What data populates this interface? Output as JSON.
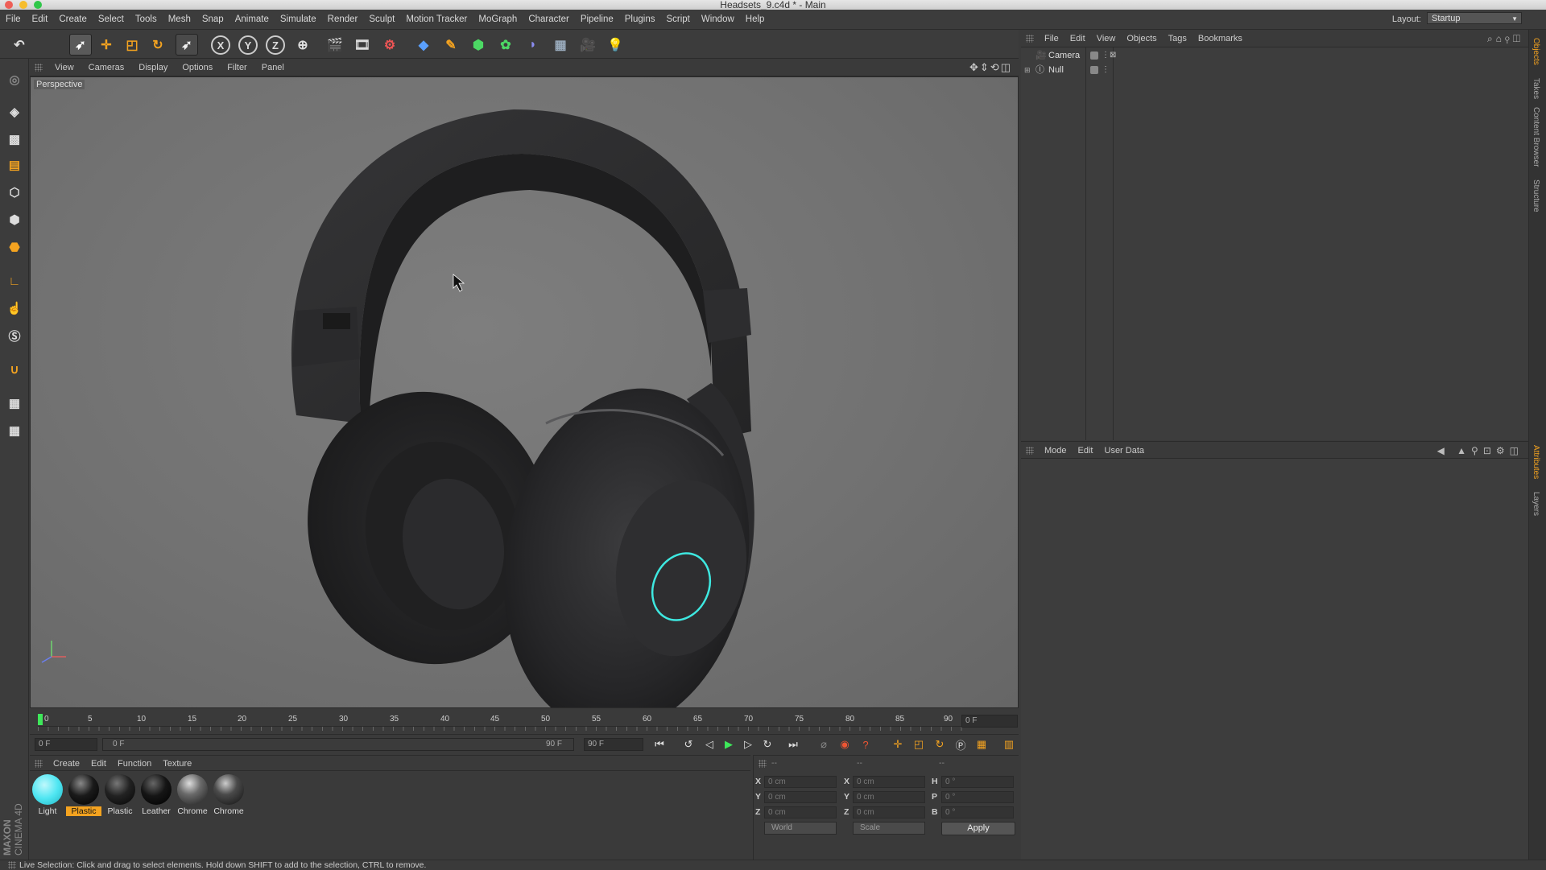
{
  "window": {
    "title": "Headsets_9.c4d * - Main"
  },
  "menu": [
    "File",
    "Edit",
    "Create",
    "Select",
    "Tools",
    "Mesh",
    "Snap",
    "Animate",
    "Simulate",
    "Render",
    "Sculpt",
    "Motion Tracker",
    "MoGraph",
    "Character",
    "Pipeline",
    "Plugins",
    "Script",
    "Window",
    "Help"
  ],
  "layout": {
    "label": "Layout:",
    "value": "Startup"
  },
  "viewport": {
    "menu": [
      "View",
      "Cameras",
      "Display",
      "Options",
      "Filter",
      "Panel"
    ],
    "label": "Perspective"
  },
  "timeline": {
    "ticks": [
      "0",
      "5",
      "10",
      "15",
      "20",
      "25",
      "30",
      "35",
      "40",
      "45",
      "50",
      "55",
      "60",
      "65",
      "70",
      "75",
      "80",
      "85",
      "90"
    ],
    "current_frame_right": "0 F",
    "start_field": "0 F",
    "range_start": "0 F",
    "range_end": "90 F",
    "end_field": "90 F"
  },
  "materials": {
    "menu": [
      "Create",
      "Edit",
      "Function",
      "Texture"
    ],
    "items": [
      {
        "label": "Light",
        "color": "#4fe6f2",
        "selected": false
      },
      {
        "label": "Plastic",
        "color": "#1a1a1a",
        "selected": true
      },
      {
        "label": "Plastic",
        "color": "#222222",
        "selected": false
      },
      {
        "label": "Leather",
        "color": "#151515",
        "selected": false
      },
      {
        "label": "Chrome",
        "color": "#6a6a6a",
        "selected": false
      },
      {
        "label": "Chrome",
        "color": "#4a4a4a",
        "selected": false
      }
    ]
  },
  "coordinates": {
    "headers": [
      "--",
      "--",
      "--"
    ],
    "rows": [
      {
        "l1": "X",
        "v1": "0 cm",
        "l2": "X",
        "v2": "0 cm",
        "l3": "H",
        "v3": "0 °"
      },
      {
        "l1": "Y",
        "v1": "0 cm",
        "l2": "Y",
        "v2": "0 cm",
        "l3": "P",
        "v3": "0 °"
      },
      {
        "l1": "Z",
        "v1": "0 cm",
        "l2": "Z",
        "v2": "0 cm",
        "l3": "B",
        "v3": "0 °"
      }
    ],
    "space": "World",
    "mode": "Scale",
    "apply": "Apply"
  },
  "objects": {
    "menu": [
      "File",
      "Edit",
      "View",
      "Objects",
      "Tags",
      "Bookmarks"
    ],
    "items": [
      {
        "name": "Camera"
      },
      {
        "name": "Null"
      }
    ]
  },
  "attributes": {
    "menu": [
      "Mode",
      "Edit",
      "User Data"
    ]
  },
  "right_tabs": [
    "Objects",
    "Takes",
    "Content Browser",
    "Structure",
    "Attributes",
    "Layers"
  ],
  "status": "Live Selection: Click and drag to select elements. Hold down SHIFT to add to the selection, CTRL to remove.",
  "brand": {
    "line1": "MAXON",
    "line2": "CINEMA 4D"
  },
  "colors": {
    "accent": "#f4a320",
    "glow": "#3ee8e0",
    "ui_bg": "#3a3a3a"
  }
}
